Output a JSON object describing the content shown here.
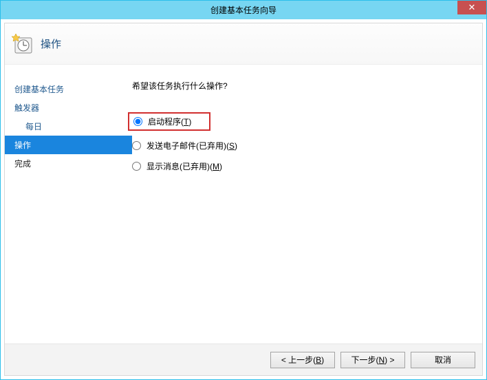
{
  "window": {
    "title": "创建基本任务向导"
  },
  "header": {
    "title": "操作"
  },
  "sidebar": {
    "items": [
      {
        "label": "创建基本任务",
        "indent": false,
        "selected": false,
        "link": true
      },
      {
        "label": "触发器",
        "indent": false,
        "selected": false,
        "link": true
      },
      {
        "label": "每日",
        "indent": true,
        "selected": false,
        "link": true
      },
      {
        "label": "操作",
        "indent": false,
        "selected": true,
        "link": false
      },
      {
        "label": "完成",
        "indent": false,
        "selected": false,
        "link": false
      }
    ]
  },
  "main": {
    "question": "希望该任务执行什么操作?",
    "options": [
      {
        "label_pre": "启动程序(",
        "accel": "T",
        "label_post": ")",
        "checked": true,
        "highlighted": true
      },
      {
        "label_pre": "发送电子邮件(已弃用)(",
        "accel": "S",
        "label_post": ")",
        "checked": false,
        "highlighted": false
      },
      {
        "label_pre": "显示消息(已弃用)(",
        "accel": "M",
        "label_post": ")",
        "checked": false,
        "highlighted": false
      }
    ]
  },
  "footer": {
    "back_pre": "< 上一步(",
    "back_accel": "B",
    "back_post": ")",
    "next_pre": "下一步(",
    "next_accel": "N",
    "next_post": ") >",
    "cancel": "取消"
  }
}
